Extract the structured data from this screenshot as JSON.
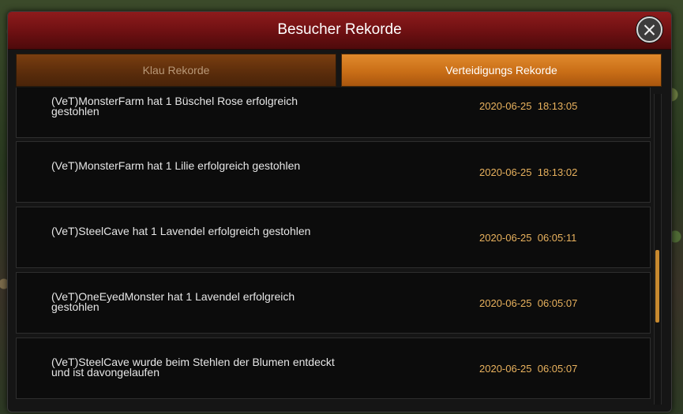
{
  "dialog": {
    "title": "Besucher Rekorde",
    "close_icon": "close-icon"
  },
  "tabs": [
    {
      "label": "Klau Rekorde",
      "active": false
    },
    {
      "label": "Verteidigungs Rekorde",
      "active": true
    }
  ],
  "records": [
    {
      "message": "(VeT)MonsterFarm hat 1 Büschel Rose erfolgreich gestohlen",
      "timestamp": "2020-06-25  18:13:05"
    },
    {
      "message": "(VeT)MonsterFarm hat 1 Lilie erfolgreich gestohlen",
      "timestamp": "2020-06-25  18:13:02"
    },
    {
      "message": "(VeT)SteelCave hat 1 Lavendel erfolgreich gestohlen",
      "timestamp": "2020-06-25  06:05:11"
    },
    {
      "message": "(VeT)OneEyedMonster hat 1 Lavendel erfolgreich gestohlen",
      "timestamp": "2020-06-25  06:05:07"
    },
    {
      "message": "(VeT)SteelCave wurde beim Stehlen der Blumen entdeckt und ist davongelaufen",
      "timestamp": "2020-06-25  06:05:07"
    }
  ],
  "colors": {
    "header_red": "#7a1416",
    "tab_active_orange": "#c96e17",
    "timestamp_gold": "#e9b25e",
    "scroll_thumb": "#c7892f"
  },
  "scroll_position_fraction": 0.72
}
